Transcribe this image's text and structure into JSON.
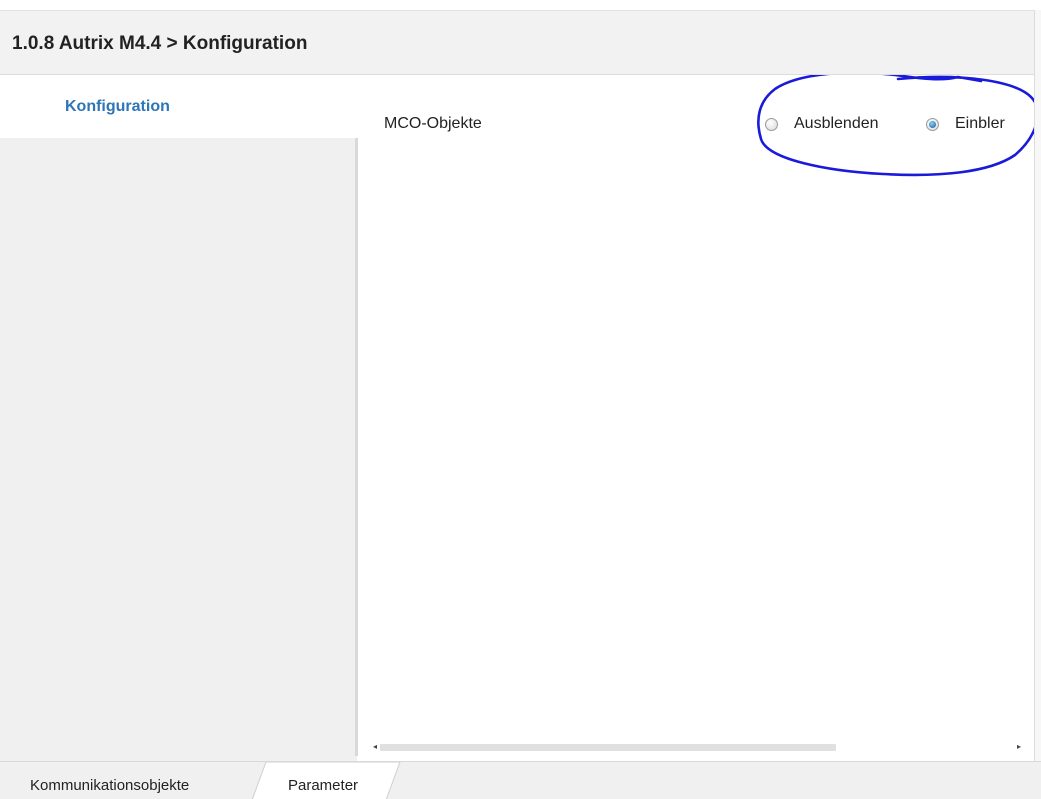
{
  "header": {
    "title": "1.0.8 Autrix M4.4 > Konfiguration"
  },
  "sidebar": {
    "items": [
      {
        "label": "Konfiguration",
        "selected": true
      }
    ]
  },
  "parameters": [
    {
      "label": "MCO-Objekte",
      "options": [
        {
          "label": "Ausblenden",
          "checked": false
        },
        {
          "label": "Einbler",
          "checked": true
        }
      ]
    }
  ],
  "tabs": [
    {
      "label": "Kommunikationsobjekte",
      "active": false
    },
    {
      "label": "Parameter",
      "active": true
    }
  ],
  "scrollbar": {
    "left_arrow": "◂",
    "right_arrow": "▸"
  },
  "colors": {
    "nav_selected_text": "#2e75b6",
    "annotation_ink": "#1a1adb",
    "radio_checked": "#1f6fb0"
  }
}
